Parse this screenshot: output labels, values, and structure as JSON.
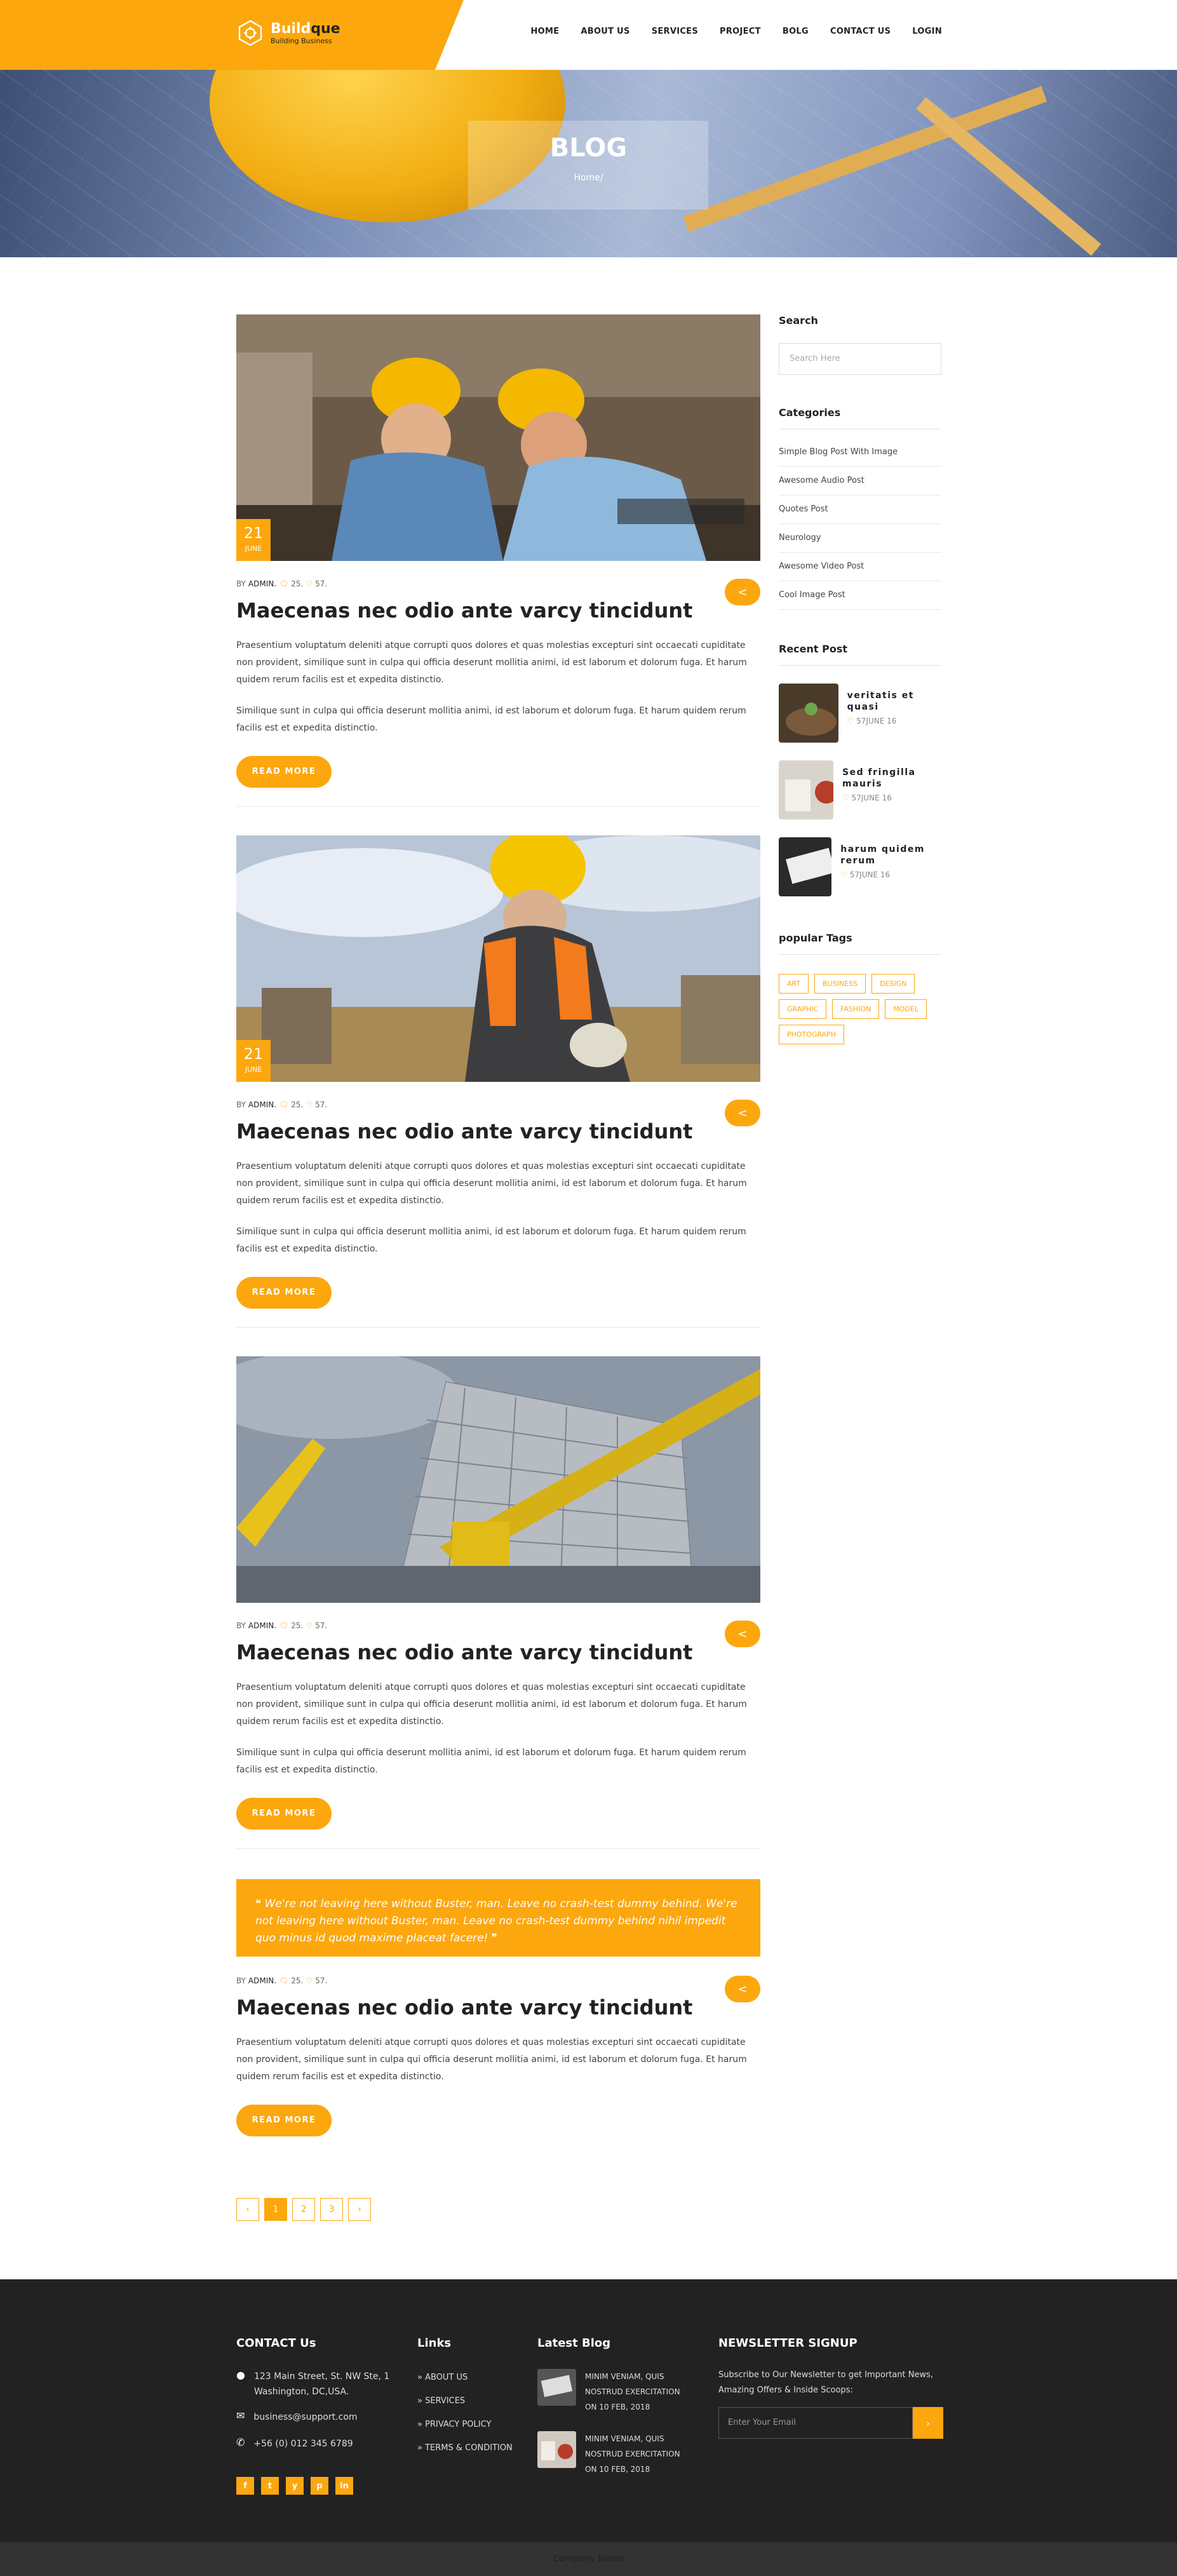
{
  "header": {
    "logo_name_a": "Build",
    "logo_name_b": "que",
    "logo_tagline": "Building Business",
    "nav": [
      "HOME",
      "ABOUT US",
      "SERVICES",
      "PROJECT",
      "BOLG",
      "CONTACT US",
      "LOGIN"
    ]
  },
  "hero": {
    "title": "BLOG",
    "breadcrumb": "Home/"
  },
  "posts": [
    {
      "day": "21",
      "month": "JUNE",
      "by": "BY",
      "author": "ADMIN.",
      "comments": "25.",
      "likes": "57.",
      "title": "Maecenas nec odio ante varcy tincidunt",
      "p1": "Praesentium voluptatum deleniti atque corrupti quos dolores et quas molestias excepturi sint occaecati cupiditate non provident, similique sunt in culpa qui officia deserunt mollitia animi, id est laborum et dolorum fuga. Et harum quidem rerum facilis est et expedita distinctio.",
      "p2": "Similique sunt in culpa qui officia deserunt mollitia animi, id est laborum et dolorum fuga. Et harum quidem rerum facilis est et expedita distinctio.",
      "read_more": "READ MORE"
    },
    {
      "day": "21",
      "month": "JUNE",
      "by": "BY",
      "author": "ADMIN.",
      "comments": "25.",
      "likes": "57.",
      "title": "Maecenas nec odio ante varcy tincidunt",
      "p1": "Praesentium voluptatum deleniti atque corrupti quos dolores et quas molestias excepturi sint occaecati cupiditate non provident, similique sunt in culpa qui officia deserunt mollitia animi, id est laborum et dolorum fuga. Et harum quidem rerum facilis est et expedita distinctio.",
      "p2": "Similique sunt in culpa qui officia deserunt mollitia animi, id est laborum et dolorum fuga. Et harum quidem rerum facilis est et expedita distinctio.",
      "read_more": "READ MORE"
    },
    {
      "by": "BY",
      "author": "ADMIN.",
      "comments": "25.",
      "likes": "57.",
      "title": "Maecenas nec odio ante varcy tincidunt",
      "p1": "Praesentium voluptatum deleniti atque corrupti quos dolores et quas molestias excepturi sint occaecati cupiditate non provident, similique sunt in culpa qui officia deserunt mollitia animi, id est laborum et dolorum fuga. Et harum quidem rerum facilis est et expedita distinctio.",
      "p2": "Similique sunt in culpa qui officia deserunt mollitia animi, id est laborum et dolorum fuga. Et harum quidem rerum facilis est et expedita distinctio.",
      "read_more": "READ MORE"
    },
    {
      "quote": "We're not leaving here without Buster, man. Leave no crash-test dummy behind. We're not leaving here without Buster, man. Leave no crash-test dummy behind nihil impedit quo minus id quod maxime placeat facere!",
      "by": "BY",
      "author": "ADMIN.",
      "comments": "25.",
      "likes": "57.",
      "title": "Maecenas nec odio ante varcy tincidunt",
      "p1": "Praesentium voluptatum deleniti atque corrupti quos dolores et quas molestias excepturi sint occaecati cupiditate non provident, similique sunt in culpa qui officia deserunt mollitia animi, id est laborum et dolorum fuga. Et harum quidem rerum facilis est et expedita distinctio.",
      "read_more": "READ MORE"
    }
  ],
  "pagination": [
    "‹",
    "1",
    "2",
    "3",
    "›"
  ],
  "sidebar": {
    "search_heading": "Search",
    "search_placeholder": "Search Here",
    "categories_heading": "Categories",
    "categories": [
      "Simple Blog Post With Image",
      "Awesome Audio Post",
      "Quotes Post",
      "Neurology",
      "Awesome Video Post",
      "Cool Image Post"
    ],
    "recent_heading": "Recent Post",
    "recent": [
      {
        "title": "veritatis et quasi",
        "likes": "57",
        "date": "JUNE 16"
      },
      {
        "title": "Sed fringilla mauris",
        "likes": "57",
        "date": "JUNE 16"
      },
      {
        "title": "harum quidem rerum",
        "likes": "57",
        "date": "JUNE 16"
      }
    ],
    "tags_heading": "popular Tags",
    "tags": [
      "ART",
      "BUSINESS",
      "DESIGN",
      "GRAPHIC",
      "FASHION",
      "MODEL",
      "PHOTOGRAPH"
    ]
  },
  "footer": {
    "contact_heading": "CONTACT Us",
    "address": "123 Main Street, St. NW Ste, 1 Washington, DC,USA.",
    "email": "business@support.com",
    "phone": "+56 (0) 012 345 6789",
    "socials": [
      "f",
      "t",
      "y",
      "p",
      "in"
    ],
    "links_heading": "Links",
    "links": [
      "ABOUT US",
      "SERVICES",
      "PRIVACY POLICY",
      "TERMS & CONDITION"
    ],
    "blog_heading": "Latest Blog",
    "blog": [
      {
        "text": "MINIM VENIAM, QUIS NOSTRUD EXERCITATION",
        "date": "ON 10 FEB, 2018"
      },
      {
        "text": "MINIM VENIAM, QUIS NOSTRUD EXERCITATION",
        "date": "ON 10 FEB, 2018"
      }
    ],
    "newsletter_heading": "NEWSLETTER SIGNUP",
    "newsletter_text": "Subscribe to Our Newsletter to get Important News, Amazing Offers & Inside Scoops:",
    "newsletter_placeholder": "Enter Your Email"
  },
  "copyright": "Company Name",
  "colors": {
    "accent": "#FCA70E",
    "dark": "#222222",
    "footer_bottom": "#333333"
  }
}
